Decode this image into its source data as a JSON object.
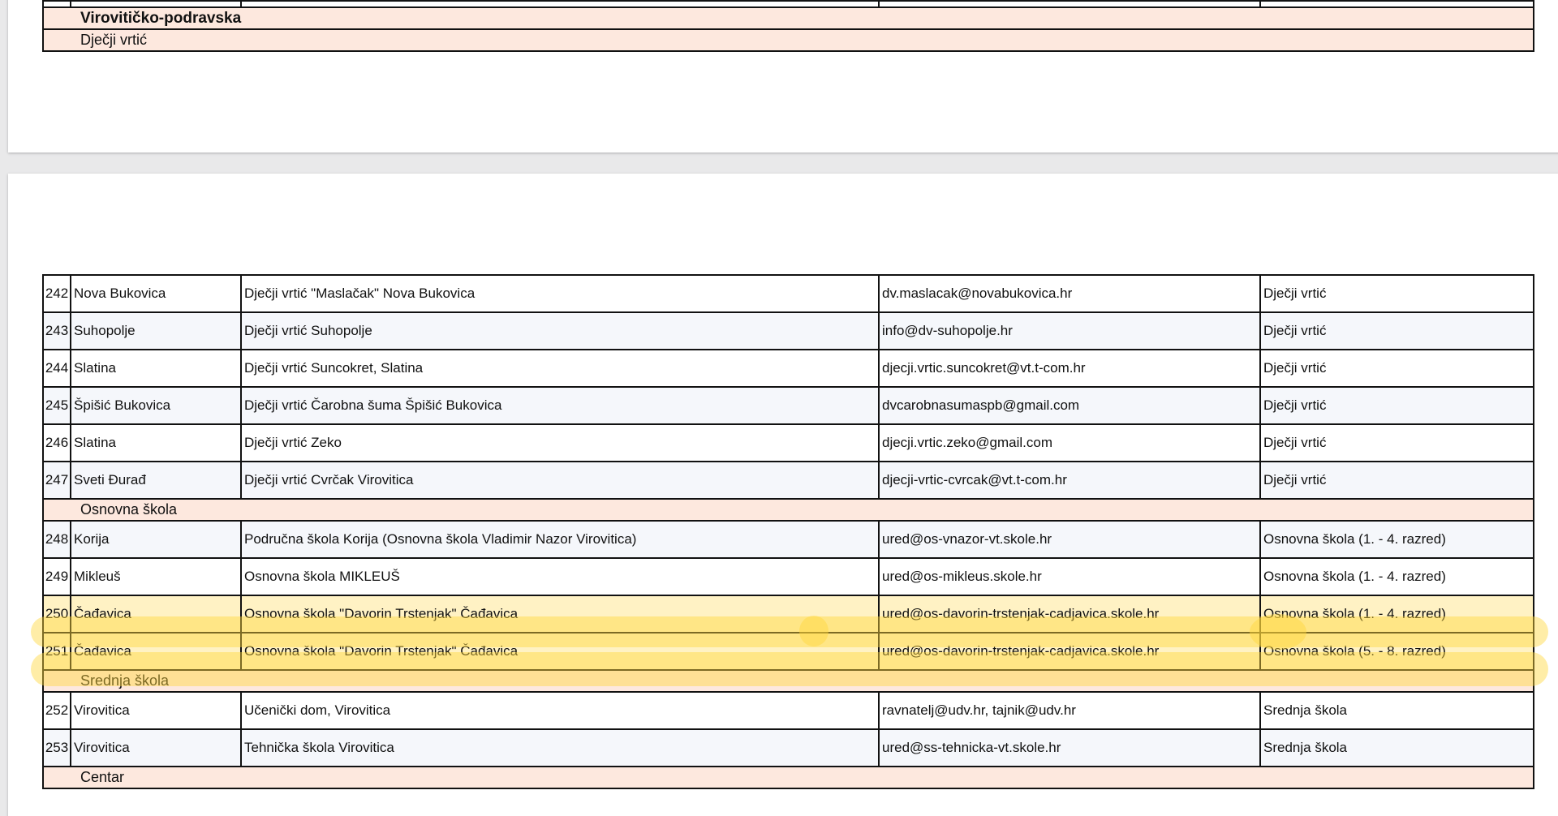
{
  "page1": {
    "strip_cells": [
      "",
      "",
      "",
      "",
      ""
    ],
    "region": "Virovitičko-podravska",
    "section": "Dječji vrtić"
  },
  "page2": {
    "rows_a": [
      {
        "num": "242",
        "place": "Nova Bukovica",
        "name": "Dječji vrtić \"Maslačak\" Nova Bukovica",
        "email": "dv.maslacak@novabukovica.hr",
        "type": "Dječji vrtić"
      },
      {
        "num": "243",
        "place": "Suhopolje",
        "name": "Dječji vrtić Suhopolje",
        "email": "info@dv-suhopolje.hr",
        "type": "Dječji vrtić"
      },
      {
        "num": "244",
        "place": "Slatina",
        "name": "Dječji vrtić Suncokret, Slatina",
        "email": "djecji.vrtic.suncokret@vt.t-com.hr",
        "type": "Dječji vrtić"
      },
      {
        "num": "245",
        "place": "Špišić Bukovica",
        "name": "Dječji vrtić Čarobna šuma Špišić Bukovica",
        "email": "dvcarobnasumaspb@gmail.com",
        "type": "Dječji vrtić"
      },
      {
        "num": "246",
        "place": "Slatina",
        "name": "Dječji vrtić Zeko",
        "email": "djecji.vrtic.zeko@gmail.com",
        "type": "Dječji vrtić"
      },
      {
        "num": "247",
        "place": "Sveti Đurađ",
        "name": "Dječji vrtić Cvrčak Virovitica",
        "email": "djecji-vrtic-cvrcak@vt.t-com.hr",
        "type": "Dječji vrtić"
      }
    ],
    "section_os": "Osnovna škola",
    "rows_b": [
      {
        "num": "248",
        "place": "Korija",
        "name": "Područna škola Korija (Osnovna škola Vladimir Nazor Virovitica)",
        "email": "ured@os-vnazor-vt.skole.hr",
        "type": "Osnovna škola (1. - 4. razred)"
      },
      {
        "num": "249",
        "place": "Mikleuš",
        "name": "Osnovna škola MIKLEUŠ",
        "email": "ured@os-mikleus.skole.hr",
        "type": "Osnovna škola (1. - 4. razred)"
      },
      {
        "num": "250",
        "place": "Čađavica",
        "name": "Osnovna škola \"Davorin Trstenjak\" Čađavica",
        "email": "ured@os-davorin-trstenjak-cadjavica.skole.hr",
        "type": "Osnovna škola (1. - 4. razred)"
      },
      {
        "num": "251",
        "place": "Čađavica",
        "name": "Osnovna škola \"Davorin Trstenjak\" Čađavica",
        "email": "ured@os-davorin-trstenjak-cadjavica.skole.hr",
        "type": "Osnovna škola (5. - 8. razred)"
      }
    ],
    "section_ss": "Srednja škola",
    "rows_c": [
      {
        "num": "252",
        "place": "Virovitica",
        "name": "Učenički dom, Virovitica",
        "email": "ravnatelj@udv.hr, tajnik@udv.hr",
        "type": "Srednja škola"
      },
      {
        "num": "253",
        "place": "Virovitica",
        "name": "Tehnička škola Virovitica",
        "email": "ured@ss-tehnicka-vt.skole.hr",
        "type": "Srednja škola"
      }
    ],
    "section_centar": "Centar"
  },
  "highlight_color": "#ffd63c"
}
